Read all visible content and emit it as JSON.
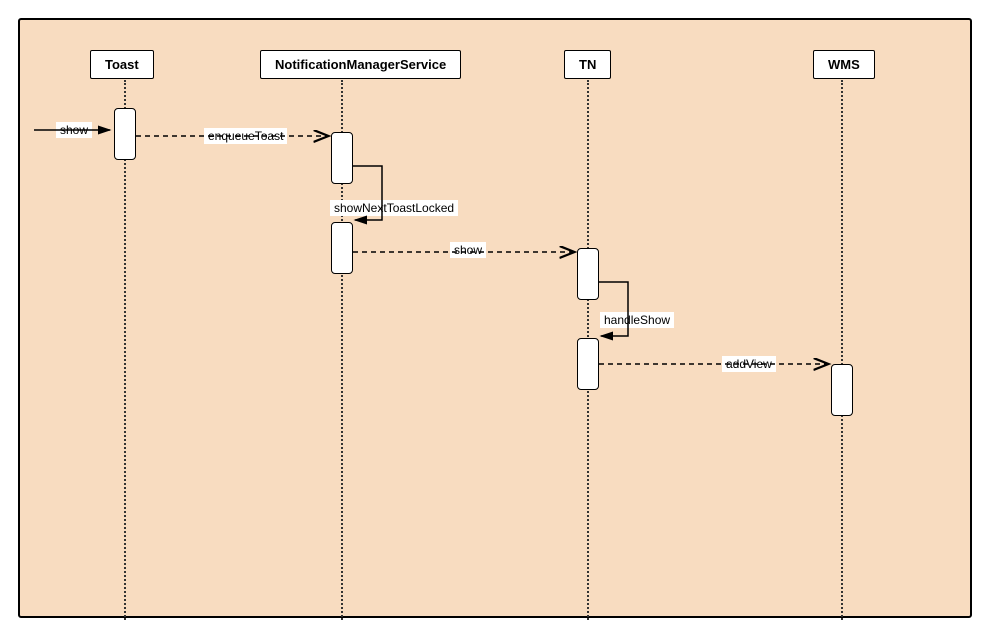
{
  "participants": {
    "p1": "Toast",
    "p2": "NotificationManagerService",
    "p3": "TN",
    "p4": "WMS"
  },
  "messages": {
    "m1": "show",
    "m2": "enqueueToast",
    "m3": "showNextToastLocked",
    "m4": "show",
    "m5": "handleShow",
    "m6": "addView"
  }
}
